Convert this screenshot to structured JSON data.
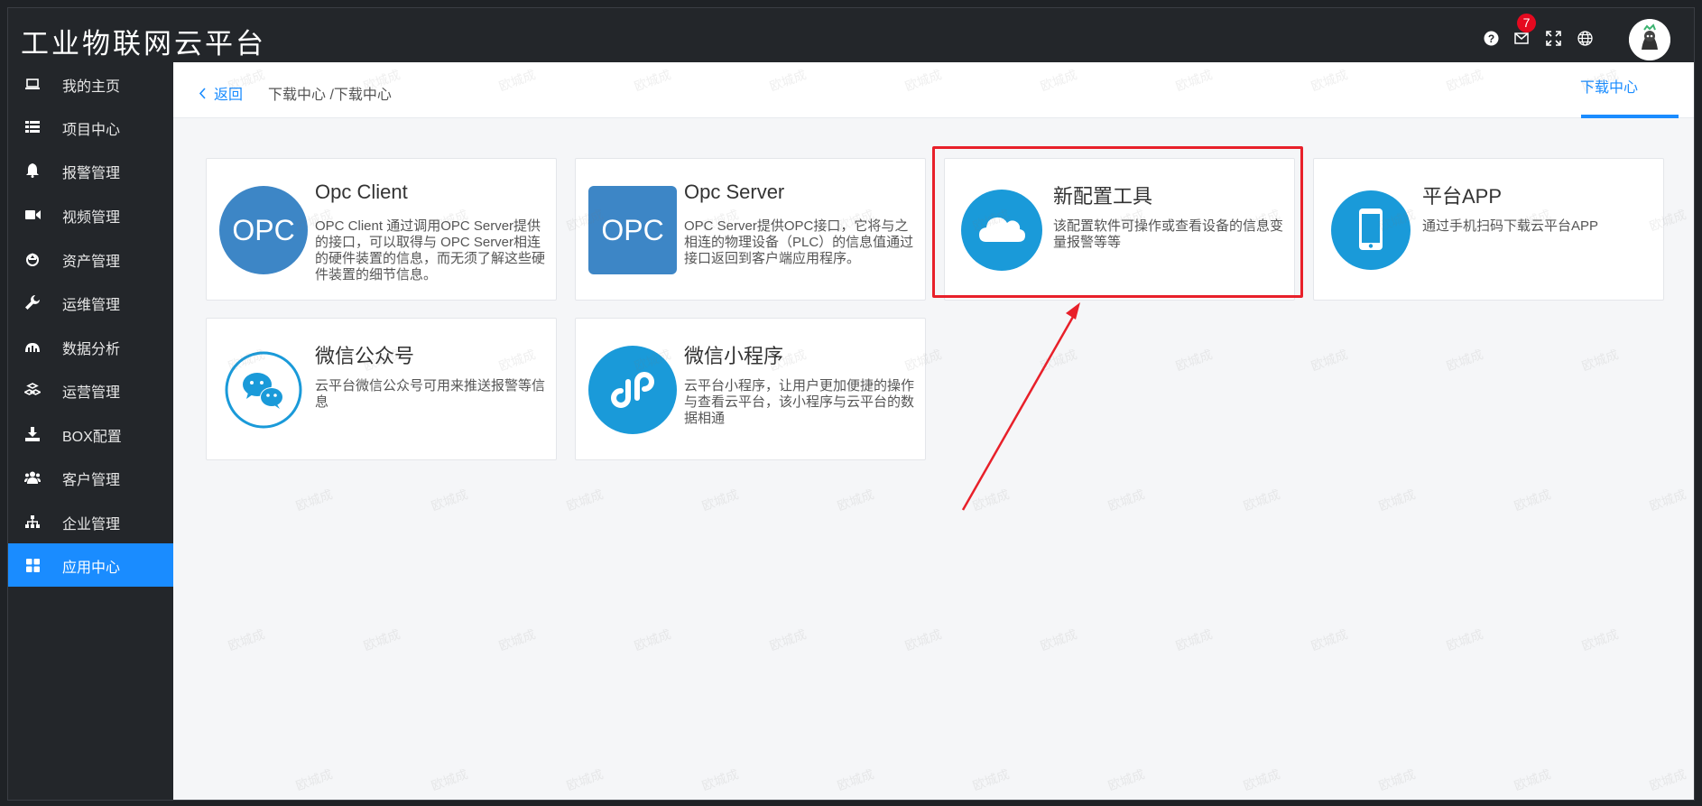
{
  "header": {
    "app_title": "工业物联网云平台",
    "mail_badge": "7",
    "icons": [
      "help-icon",
      "mail-icon",
      "fullscreen-icon",
      "globe-icon"
    ]
  },
  "sidebar": {
    "items": [
      {
        "label": "我的主页",
        "icon": "monitor-icon"
      },
      {
        "label": "项目中心",
        "icon": "list-icon"
      },
      {
        "label": "报警管理",
        "icon": "bell-icon"
      },
      {
        "label": "视频管理",
        "icon": "video-icon"
      },
      {
        "label": "资产管理",
        "icon": "recycle-icon"
      },
      {
        "label": "运维管理",
        "icon": "wrench-icon"
      },
      {
        "label": "数据分析",
        "icon": "chart-icon"
      },
      {
        "label": "运营管理",
        "icon": "cubes-icon"
      },
      {
        "label": "BOX配置",
        "icon": "download-icon"
      },
      {
        "label": "客户管理",
        "icon": "users-icon"
      },
      {
        "label": "企业管理",
        "icon": "sitemap-icon"
      },
      {
        "label": "应用中心",
        "icon": "grid-icon",
        "active": true
      }
    ]
  },
  "page": {
    "back_label": "返回",
    "breadcrumb": "下载中心 /下载中心",
    "tab_label": "下载中心"
  },
  "cards": [
    {
      "title": "Opc Client",
      "desc": "OPC Client 通过调用OPC Server提供的接口，可以取得与 OPC Server相连的硬件装置的信息，而无须了解这些硬件装置的细节信息。",
      "logo_text": "OPC",
      "icon": "opc-client-logo"
    },
    {
      "title": "Opc Server",
      "desc": "OPC Server提供OPC接口，它将与之相连的物理设备（PLC）的信息值通过接口返回到客户端应用程序。",
      "logo_text": "OPC",
      "icon": "opc-server-logo"
    },
    {
      "title": "新配置工具",
      "desc": "该配置软件可操作或查看设备的信息变量报警等等",
      "icon": "cloud-icon"
    },
    {
      "title": "平台APP",
      "desc": "通过手机扫码下载云平台APP",
      "icon": "phone-icon"
    },
    {
      "title": "微信公众号",
      "desc": "云平台微信公众号可用来推送报警等信息",
      "icon": "wechat-icon"
    },
    {
      "title": "微信小程序",
      "desc": "云平台小程序，让用户更加便捷的操作与查看云平台，该小程序与云平台的数据相通",
      "icon": "miniprogram-icon"
    }
  ],
  "watermark": "欧城成",
  "colors": {
    "accent": "#1a8cff",
    "highlight": "#e8202a",
    "sidebar": "#23262a"
  }
}
